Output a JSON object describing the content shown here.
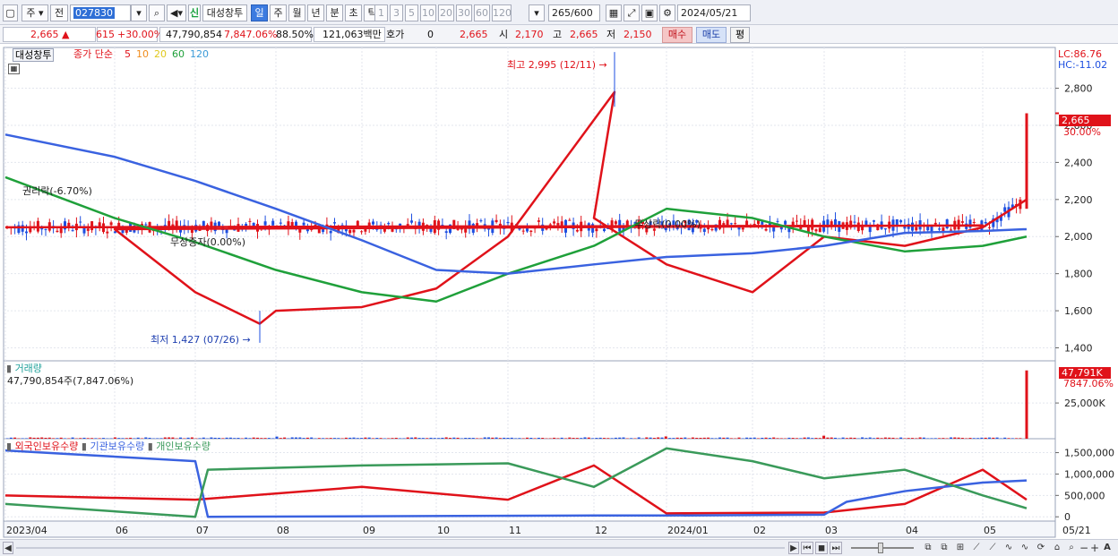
{
  "toolbar": {
    "mode": "주",
    "prev_label": "전",
    "code": "027830",
    "market_tag": "신",
    "stock_name": "대성창투",
    "periods": [
      "일",
      "주",
      "월",
      "년",
      "분",
      "초",
      "틱"
    ],
    "active_period": "일",
    "intervals": [
      "1",
      "3",
      "5",
      "10",
      "20",
      "30",
      "60",
      "120"
    ],
    "count": "265",
    "count_total": "/600",
    "date": "2024/05/21"
  },
  "quote": {
    "price": "2,665",
    "change": "615",
    "change_pct": "+30.00%",
    "volume": "47,790,854",
    "volume_pct": "7,847.06%",
    "turnover_pct": "88.50%",
    "amount": "121,063백만",
    "hoga_label": "호가",
    "hoga_value": "0",
    "current": "2,665",
    "open_label": "시",
    "open": "2,170",
    "high_label": "고",
    "high": "2,665",
    "low_label": "저",
    "low": "2,150",
    "buy_label": "매수",
    "sell_label": "매도",
    "avg_label": "평"
  },
  "price_pane": {
    "stock_tag": "대성창투",
    "ma_title": "종가 단순",
    "ma_periods": [
      "5",
      "10",
      "20",
      "60",
      "120"
    ],
    "lc_label": "LC:86.76",
    "hc_label": "HC:-11.02",
    "current_tag": "2,665",
    "current_pct": "30.00%",
    "high_annotation": "최고 2,995 (12/11)",
    "low_annotation": "최저 1,427 (07/26)",
    "event_1": "권리락(-6.70%)",
    "event_2": "무상증자(0.00%)",
    "event_3": "무상락(0.00%)"
  },
  "volume_pane": {
    "title": "거래량",
    "value_text": "47,790,854주(7,847.06%)",
    "tag_value": "47,791K",
    "tag_pct": "7847.06%"
  },
  "holdings_pane": {
    "series_names": [
      "외국인보유수량",
      "기관보유수량",
      "개인보유수량"
    ]
  },
  "colors": {
    "up": "#e0121a",
    "down": "#1e4fe0",
    "ma5": "#e0121a",
    "ma10": "#f08c1c",
    "ma20": "#f0e21c",
    "ma60": "#1fa03a",
    "ma120": "#3a62e0",
    "foreign": "#e0121a",
    "institution": "#3a62e0",
    "individual": "#3a9a5a"
  },
  "chart_data": [
    {
      "type": "line",
      "title": "",
      "y_ticks": [
        2800,
        2600,
        2400,
        2200,
        2000,
        1800,
        1600,
        1400
      ],
      "ylim": [
        1330,
        3020
      ],
      "x_ticks": [
        "2023/04",
        "06",
        "07",
        "08",
        "09",
        "10",
        "11",
        "12",
        "2024/01",
        "02",
        "03",
        "04",
        "05",
        "05/21"
      ],
      "series": [
        {
          "name": "5",
          "points": [
            [
              "2023/04",
              2050
            ],
            [
              "05",
              2060
            ],
            [
              "06",
              2040
            ],
            [
              "07",
              1700
            ],
            [
              "07/26",
              1530
            ],
            [
              "08",
              1600
            ],
            [
              "09",
              1620
            ],
            [
              "10",
              1720
            ],
            [
              "11",
              2000
            ],
            [
              "12/11",
              2780
            ],
            [
              "12",
              2100
            ],
            [
              "2024/01",
              1850
            ],
            [
              "02",
              1700
            ],
            [
              "03",
              2000
            ],
            [
              "04",
              1950
            ],
            [
              "05",
              2050
            ],
            [
              "05/21",
              2200
            ]
          ]
        },
        {
          "name": "60",
          "points": [
            [
              "2023/04",
              2320
            ],
            [
              "06",
              2100
            ],
            [
              "07",
              1970
            ],
            [
              "08",
              1820
            ],
            [
              "09",
              1700
            ],
            [
              "10",
              1650
            ],
            [
              "11",
              1800
            ],
            [
              "12",
              1950
            ],
            [
              "2024/01",
              2150
            ],
            [
              "02",
              2100
            ],
            [
              "03",
              2000
            ],
            [
              "04",
              1920
            ],
            [
              "05",
              1950
            ],
            [
              "05/21",
              2000
            ]
          ]
        },
        {
          "name": "120",
          "points": [
            [
              "2023/04",
              2550
            ],
            [
              "06",
              2430
            ],
            [
              "07",
              2300
            ],
            [
              "08",
              2150
            ],
            [
              "09",
              1980
            ],
            [
              "10",
              1820
            ],
            [
              "11",
              1800
            ],
            [
              "12",
              1850
            ],
            [
              "2024/01",
              1890
            ],
            [
              "02",
              1910
            ],
            [
              "03",
              1950
            ],
            [
              "04",
              2020
            ],
            [
              "05",
              2030
            ],
            [
              "05/21",
              2040
            ]
          ]
        }
      ],
      "annotations": {
        "high": 2995,
        "high_date": "12/11",
        "low": 1427,
        "low_date": "07/26"
      },
      "current": 2665
    },
    {
      "type": "bar",
      "title": "거래량",
      "y_ticks": [
        25000
      ],
      "values_k": {
        "2023/04": 300,
        "08": 1500,
        "12": 400,
        "2024/01": 1600,
        "03": 2100,
        "05/21": 47791
      },
      "last_value": "47,791K"
    },
    {
      "type": "line",
      "title": "",
      "y_ticks": [
        1500000,
        1000000,
        500000,
        0
      ],
      "series": [
        {
          "name": "외국인보유수량",
          "points": [
            [
              "2023/04",
              500000
            ],
            [
              "07",
              400000
            ],
            [
              "09",
              700000
            ],
            [
              "11",
              400000
            ],
            [
              "12",
              1200000
            ],
            [
              "2024/01",
              80000
            ],
            [
              "03",
              100000
            ],
            [
              "04",
              300000
            ],
            [
              "05",
              1100000
            ],
            [
              "05/21",
              400000
            ]
          ]
        },
        {
          "name": "기관보유수량",
          "points": [
            [
              "2023/04",
              1550000
            ],
            [
              "07",
              1300000
            ],
            [
              "07/10",
              0
            ],
            [
              "12",
              30000
            ],
            [
              "2024/01",
              30000
            ],
            [
              "03",
              50000
            ],
            [
              "03/20",
              350000
            ],
            [
              "04",
              600000
            ],
            [
              "05",
              800000
            ],
            [
              "05/21",
              850000
            ]
          ]
        },
        {
          "name": "개인보유수량",
          "points": [
            [
              "2023/04",
              300000
            ],
            [
              "07",
              0
            ],
            [
              "07/10",
              1100000
            ],
            [
              "09",
              1200000
            ],
            [
              "11",
              1250000
            ],
            [
              "12",
              700000
            ],
            [
              "2024/01",
              1600000
            ],
            [
              "02",
              1300000
            ],
            [
              "03",
              900000
            ],
            [
              "04",
              1100000
            ],
            [
              "05",
              500000
            ],
            [
              "05/21",
              200000
            ]
          ]
        }
      ]
    }
  ],
  "scrollbar": {
    "icons": [
      "▶",
      "⏮",
      "◼",
      "⏭",
      "+",
      "−",
      "A"
    ]
  }
}
